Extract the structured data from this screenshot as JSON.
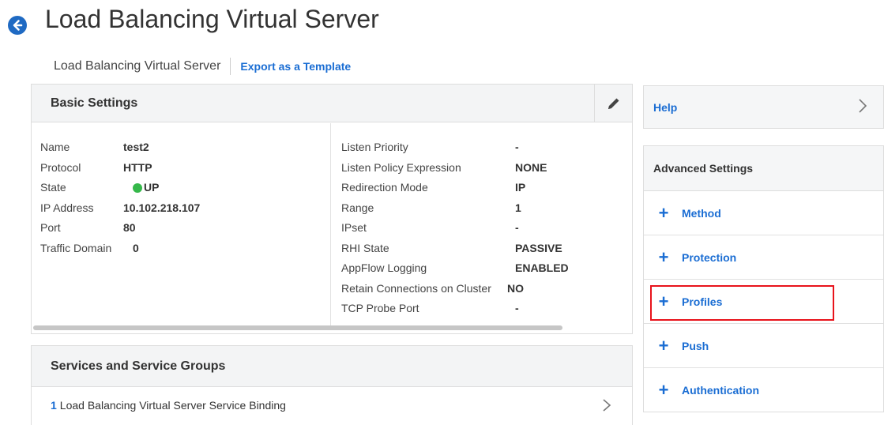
{
  "page": {
    "title": "Load Balancing Virtual Server"
  },
  "breadcrumb": {
    "current": "Load Balancing Virtual Server",
    "export_link": "Export as a Template"
  },
  "basic_settings": {
    "title": "Basic Settings",
    "left": [
      {
        "label": "Name",
        "value": "test2"
      },
      {
        "label": "Protocol",
        "value": "HTTP"
      },
      {
        "label": "State",
        "value": "UP",
        "status_color": "#35b84a"
      },
      {
        "label": "IP Address",
        "value": "10.102.218.107"
      },
      {
        "label": "Port",
        "value": "80"
      },
      {
        "label": "Traffic Domain",
        "value": "0"
      }
    ],
    "right": [
      {
        "label": "Listen Priority",
        "value": "-"
      },
      {
        "label": "Listen Policy Expression",
        "value": "NONE"
      },
      {
        "label": "Redirection Mode",
        "value": "IP"
      },
      {
        "label": "Range",
        "value": "1"
      },
      {
        "label": "IPset",
        "value": "-"
      },
      {
        "label": "RHI State",
        "value": "PASSIVE"
      },
      {
        "label": "AppFlow Logging",
        "value": "ENABLED"
      },
      {
        "label": "Retain Connections on Cluster",
        "value": "NO"
      },
      {
        "label": "TCP Probe Port",
        "value": "-"
      }
    ]
  },
  "services": {
    "title": "Services and Service Groups",
    "binding": {
      "count": "1",
      "label": "Load Balancing Virtual Server Service Binding"
    }
  },
  "help": {
    "label": "Help"
  },
  "advanced": {
    "title": "Advanced Settings",
    "items": [
      {
        "label": "Method"
      },
      {
        "label": "Protection"
      },
      {
        "label": "Profiles"
      },
      {
        "label": "Push"
      },
      {
        "label": "Authentication"
      }
    ]
  },
  "colors": {
    "accent": "#1a6dd3",
    "status_up": "#35b84a",
    "highlight": "#e8131b"
  }
}
